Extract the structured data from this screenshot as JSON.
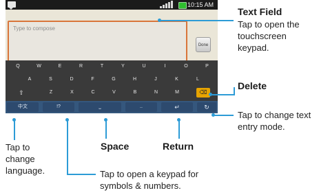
{
  "status_bar": {
    "time": "10:15 AM"
  },
  "compose": {
    "placeholder": "Type to compose",
    "done_label": "Done"
  },
  "keyboard": {
    "row1": [
      "Q",
      "W",
      "E",
      "R",
      "T",
      "Y",
      "U",
      "I",
      "O",
      "P"
    ],
    "row2": [
      "A",
      "S",
      "D",
      "F",
      "G",
      "H",
      "J",
      "K",
      "L"
    ],
    "row3": [
      "Z",
      "X",
      "C",
      "V",
      "B",
      "N",
      "M"
    ],
    "shift_glyph": "⇧",
    "delete_glyph": "⌫",
    "language_key": "中文",
    "symbols_key": "!?",
    "space_glyph": "⎵",
    "dots_key": "..",
    "return_glyph": "↵",
    "mode_glyph": "↻"
  },
  "callouts": {
    "text_field": {
      "title": "Text Field",
      "line1": "Tap to open the",
      "line2": "touchscreen",
      "line3": "keypad."
    },
    "delete": {
      "title": "Delete"
    },
    "entry_mode": {
      "line1": "Tap to change text",
      "line2": "entry mode."
    },
    "language": {
      "line1": "Tap to",
      "line2": "change",
      "line3": "language."
    },
    "space": {
      "title": "Space"
    },
    "return": {
      "title": "Return"
    },
    "symbols": {
      "line1": "Tap to open a keypad for",
      "line2": "symbols & numbers."
    }
  },
  "colors": {
    "accent": "#2c9bd6",
    "compose_border": "#d9753a",
    "delete_key": "#e7a400"
  }
}
